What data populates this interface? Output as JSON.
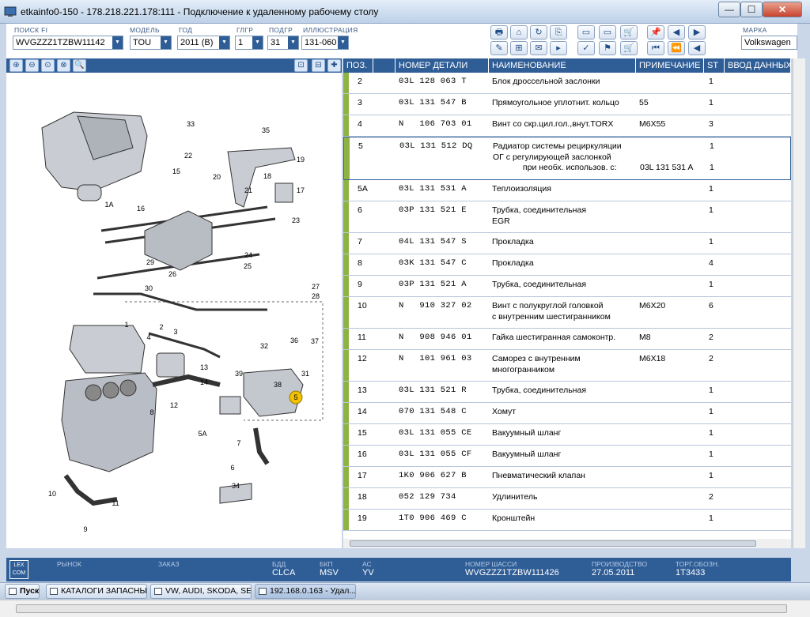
{
  "window": {
    "title": "etkainfo0-150 - 178.218.221.178:111 - Подключение к удаленному рабочему столу",
    "min_glyph": "—",
    "max_glyph": "☐",
    "close_glyph": "✕"
  },
  "toolbar": {
    "search_label": "ПОИСК FI",
    "search_value": "WVGZZZ1TZBW11142",
    "model_label": "МОДЕЛЬ",
    "model_value": "TOU",
    "year_label": "ГОД",
    "year_value": "2011 (B)",
    "group_label": "ГЛГР",
    "group_value": "1",
    "subgroup_label": "ПОДГР",
    "subgroup_value": "31",
    "illustration_label": "ИЛЛЮСТРАЦИЯ",
    "illustration_value": "131-060",
    "brand_label": "МАРКА",
    "brand_value": "Volkswagen",
    "dropdown_glyph": "▼",
    "button_glyphs": [
      "🖶",
      "⌂",
      "↻",
      "⎘",
      "▭",
      "▭",
      "🛒",
      "✎",
      "⊞",
      "✉",
      "▸",
      "✓",
      "⚑",
      "🛒",
      "📌",
      "◀",
      "▶",
      "⏮",
      "⏪",
      "◀"
    ]
  },
  "illustration": {
    "tool_glyphs": [
      "⊕",
      "⊖",
      "⊙",
      "⊗",
      "🔍"
    ],
    "view_glyphs": [
      "⊡",
      "⊟",
      "✚"
    ],
    "callouts": [
      "1A",
      "16",
      "15",
      "33",
      "22",
      "20",
      "35",
      "19",
      "18",
      "21",
      "17",
      "23",
      "29",
      "24",
      "25",
      "26",
      "27",
      "28",
      "30",
      "36",
      "37",
      "31",
      "32",
      "2",
      "3",
      "4",
      "1",
      "13",
      "14",
      "12",
      "8",
      "9",
      "10",
      "11",
      "6",
      "7",
      "5A",
      "5",
      "38",
      "39",
      "34"
    ],
    "highlighted_callout": "5"
  },
  "table": {
    "headers": [
      "ПОЗ.",
      "",
      "НОМЕР ДЕТАЛИ",
      "НАИМЕНОВАНИЕ",
      "ПРИМЕЧАНИЕ",
      "ST",
      "ВВОД ДАННЫХ"
    ],
    "rows": [
      {
        "pos": "2",
        "part": "03L 128 063 T",
        "name": "Блок дроссельной заслонки",
        "note": "",
        "qty": "1"
      },
      {
        "pos": "3",
        "part": "03L 131 547 B",
        "name": "Прямоугольное уплотнит. кольцо",
        "note": "55",
        "qty": "1"
      },
      {
        "pos": "4",
        "part": "N   106 703 01",
        "name": "Винт со скр.цил.гол.,внут.TORX",
        "note": "M6X55",
        "qty": "3"
      },
      {
        "pos": "5",
        "part": "03L 131 512 DQ",
        "name": "Радиатор системы рециркуляции\nОГ с регулирующей заслонкой\n             при необх. использов. с:",
        "note": "\n\n03L 131 531 A",
        "qty": "1\n\n1",
        "selected": true
      },
      {
        "pos": "5A",
        "part": "03L 131 531 A",
        "name": "Теплоизоляция",
        "note": "",
        "qty": "1"
      },
      {
        "pos": "6",
        "part": "03P 131 521 E",
        "name": "Трубка, соединительная\nEGR",
        "note": "",
        "qty": "1"
      },
      {
        "pos": "7",
        "part": "04L 131 547 S",
        "name": "Прокладка",
        "note": "",
        "qty": "1"
      },
      {
        "pos": "8",
        "part": "03K 131 547 C",
        "name": "Прокладка",
        "note": "",
        "qty": "4"
      },
      {
        "pos": "9",
        "part": "03P 131 521 A",
        "name": "Трубка, соединительная",
        "note": "",
        "qty": "1"
      },
      {
        "pos": "10",
        "part": "N   910 327 02",
        "name": "Винт с полукруглой головкой\nс внутренним шестигранником",
        "note": "M6X20",
        "qty": "6"
      },
      {
        "pos": "11",
        "part": "N   908 946 01",
        "name": "Гайка шестигранная самоконтр.",
        "note": "M8",
        "qty": "2"
      },
      {
        "pos": "12",
        "part": "N   101 961 03",
        "name": "Саморез с внутренним\nмногогранником",
        "note": "M6X18",
        "qty": "2"
      },
      {
        "pos": "13",
        "part": "03L 131 521 R",
        "name": "Трубка, соединительная",
        "note": "",
        "qty": "1"
      },
      {
        "pos": "14",
        "part": "070 131 548 C",
        "name": "Хомут",
        "note": "",
        "qty": "1"
      },
      {
        "pos": "15",
        "part": "03L 131 055 CE",
        "name": "Вакуумный шланг",
        "note": "",
        "qty": "1"
      },
      {
        "pos": "16",
        "part": "03L 131 055 CF",
        "name": "Вакуумный шланг",
        "note": "",
        "qty": "1"
      },
      {
        "pos": "17",
        "part": "1K0 906 627 B",
        "name": "Пневматический клапан",
        "note": "",
        "qty": "1"
      },
      {
        "pos": "18",
        "part": "052 129 734",
        "name": "Удлинитель",
        "note": "",
        "qty": "2"
      },
      {
        "pos": "19",
        "part": "1T0 906 469 C",
        "name": "Кронштейн",
        "note": "",
        "qty": "1"
      }
    ]
  },
  "status": {
    "market_label": "РЫНОК",
    "order_label": "ЗАКАЗ",
    "engine_label": "БДД",
    "engine_value": "CLCA",
    "gearbox_label": "БКП",
    "gearbox_value": "MSV",
    "axle_label": "АС",
    "axle_value": "YV",
    "vin_label": "НОМЕР ШАССИ",
    "vin_value": "WVGZZZ1TZBW111426",
    "prod_label": "ПРОИЗВОДСТВО",
    "prod_value": "27.05.2011",
    "trade_label": "ТОРГ.ОБОЗН.",
    "trade_value": "1T3433",
    "logo_text": "LEX\nCOM"
  },
  "taskbar": {
    "start": "Пуск",
    "tasks": [
      "КАТАЛОГИ ЗАПАСНЫХ ...",
      "VW, AUDI, SKODA, SEAT",
      "192.168.0.163 - Удал..."
    ]
  }
}
